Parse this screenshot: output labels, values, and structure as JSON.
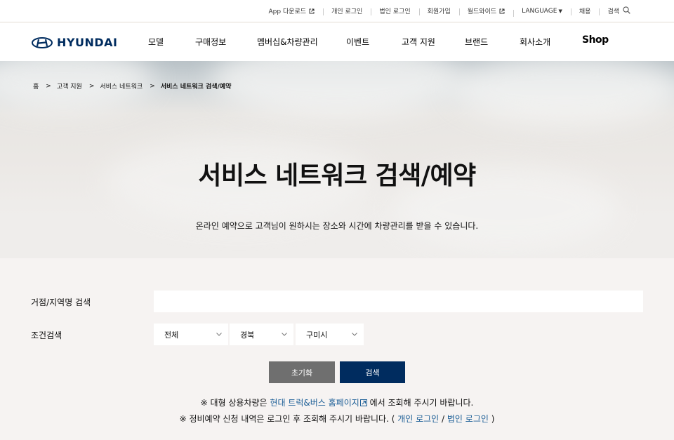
{
  "utility": {
    "app_download": "App 다운로드",
    "personal_login": "개인 로그인",
    "corporate_login": "법인 로그인",
    "signup": "회원가입",
    "worldwide": "월드와이드",
    "language": "LANGUAGE",
    "careers": "채용",
    "search": "검색"
  },
  "brand": {
    "name": "HYUNDAI",
    "color": "#002c5f"
  },
  "menu": {
    "items": [
      "모델",
      "구매정보",
      "멤버십&차량관리",
      "이벤트",
      "고객 지원",
      "브랜드",
      "회사소개"
    ],
    "shop": "Shop"
  },
  "breadcrumb": {
    "home": "홈",
    "level1": "고객 지원",
    "level2": "서비스 네트워크",
    "current": "서비스 네트워크 검색/예약"
  },
  "hero": {
    "title": "서비스 네트워크 검색/예약",
    "subtitle": "온라인 예약으로 고객님이 원하시는 장소와 시간에 차량관리를 받을 수 있습니다."
  },
  "form": {
    "location_label": "거점/지역명 검색",
    "location_value": "",
    "condition_label": "조건검색",
    "select_category": "전체",
    "select_region": "경북",
    "select_city": "구미시",
    "reset_label": "초기화",
    "search_label": "검색"
  },
  "notes": {
    "line1_prefix": "※ 대형 상용차량은 ",
    "line1_link": "현대 트럭&버스 홈페이지",
    "line1_suffix": " 에서 조회해 주시기 바랍니다.",
    "line2_prefix": "※ 정비예약 신청 내역은 로그인 후 조회해 주시기 바랍니다. ( ",
    "line2_link1": "개인 로그인",
    "line2_sep": " / ",
    "line2_link2": "법인 로그인",
    "line2_suffix": " )"
  },
  "colors": {
    "navy": "#002c5f",
    "link": "#1b5e96",
    "reset_button": "#6f6f6f"
  }
}
